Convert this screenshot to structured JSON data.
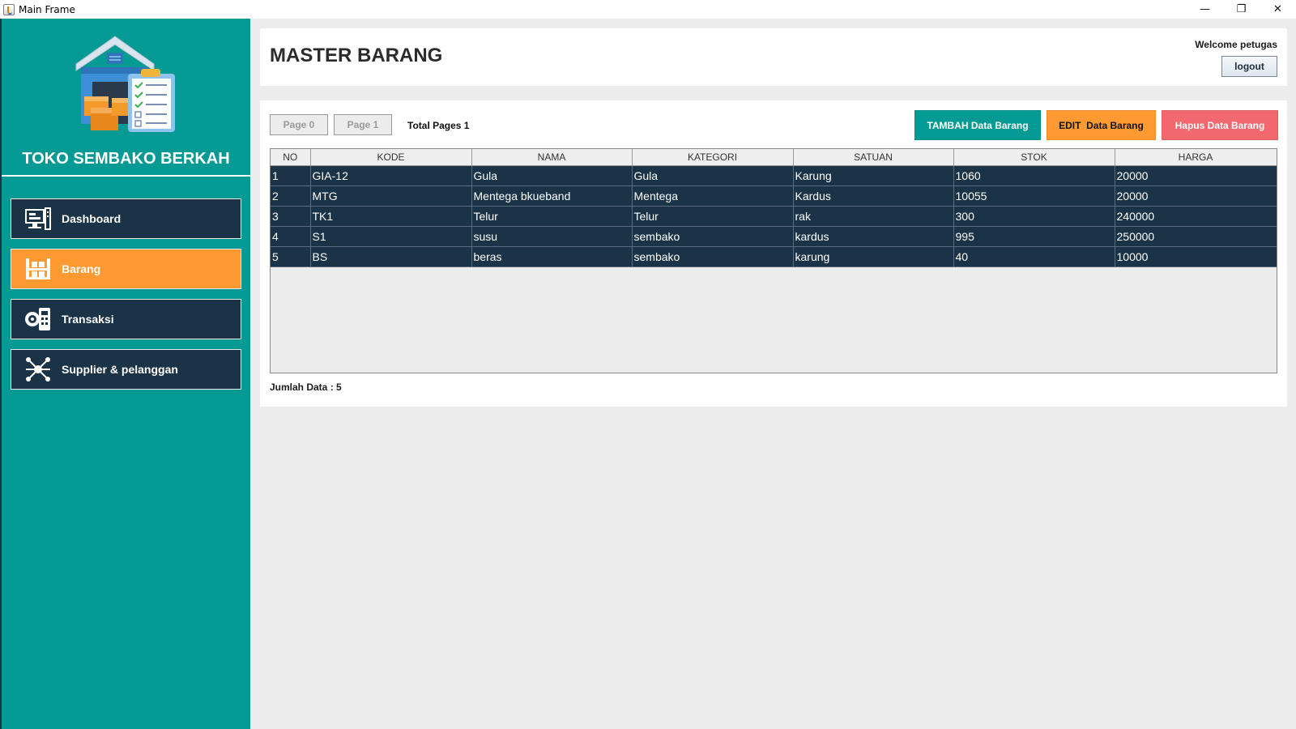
{
  "window": {
    "title": "Main Frame",
    "controls": {
      "minimize": "—",
      "restore": "❐",
      "close": "✕"
    }
  },
  "sidebar": {
    "store_name": "TOKO SEMBAKO BERKAH",
    "items": [
      {
        "label": "Dashboard",
        "icon": "dashboard-icon",
        "active": false
      },
      {
        "label": "Barang",
        "icon": "warehouse-icon",
        "active": true
      },
      {
        "label": "Transaksi",
        "icon": "transaction-icon",
        "active": false
      },
      {
        "label": "Supplier & pelanggan",
        "icon": "network-icon",
        "active": false
      }
    ]
  },
  "header": {
    "title": "MASTER BARANG",
    "welcome": "Welcome petugas",
    "logout": "logout"
  },
  "pagination": {
    "prev": "Page 0",
    "next": "Page 1",
    "total": "Total Pages 1"
  },
  "actions": {
    "add": "TAMBAH Data Barang",
    "edit": "EDIT  Data Barang",
    "delete": "Hapus Data Barang"
  },
  "table": {
    "columns": [
      "NO",
      "KODE",
      "NAMA",
      "KATEGORI",
      "SATUAN",
      "STOK",
      "HARGA"
    ],
    "rows": [
      [
        "1",
        "GIA-12",
        "Gula",
        "Gula",
        "Karung",
        "1060",
        "20000"
      ],
      [
        "2",
        "MTG",
        "Mentega bkueband",
        "Mentega",
        "Kardus",
        "10055",
        "20000"
      ],
      [
        "3",
        "TK1",
        "Telur",
        "Telur",
        "rak",
        "300",
        "240000"
      ],
      [
        "4",
        "S1",
        "susu",
        "sembako",
        "kardus",
        "995",
        "250000"
      ],
      [
        "5",
        "BS",
        "beras",
        "sembako",
        "karung",
        "40",
        "10000"
      ]
    ]
  },
  "footer": {
    "count": "Jumlah Data : 5"
  },
  "colors": {
    "teal": "#069a95",
    "navy": "#1b3346",
    "orange": "#ff9a33",
    "red": "#f2686f"
  }
}
